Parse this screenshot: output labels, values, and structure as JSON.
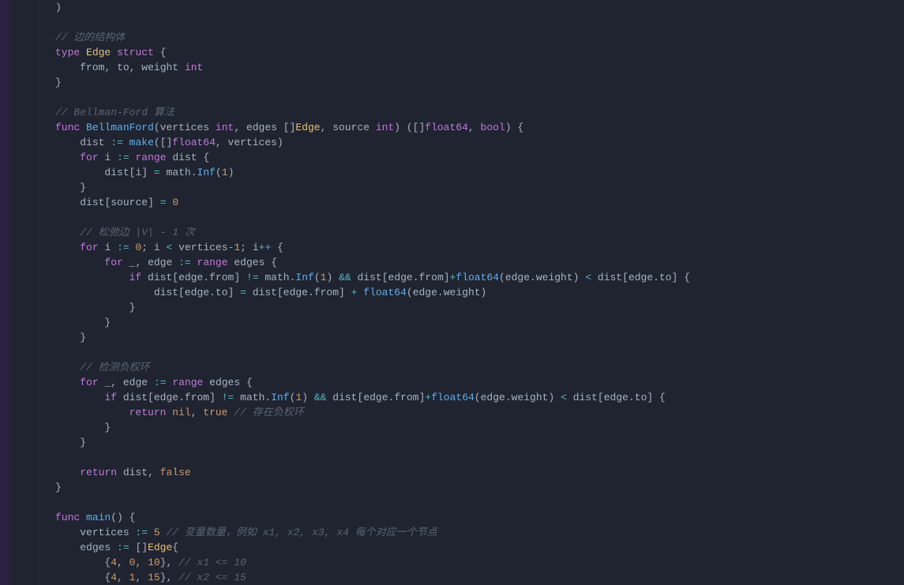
{
  "code": {
    "lines": [
      [
        [
          "punc",
          ")"
        ]
      ],
      [],
      [
        [
          "comment",
          "// 边的结构体"
        ]
      ],
      [
        [
          "keyword",
          "type"
        ],
        [
          "sp",
          " "
        ],
        [
          "struct",
          "Edge"
        ],
        [
          "sp",
          " "
        ],
        [
          "keyword",
          "struct"
        ],
        [
          "sp",
          " "
        ],
        [
          "punc",
          "{"
        ]
      ],
      [
        [
          "indent",
          "    "
        ],
        [
          "ident",
          "from"
        ],
        [
          "punc",
          ","
        ],
        [
          "sp",
          " "
        ],
        [
          "ident",
          "to"
        ],
        [
          "punc",
          ","
        ],
        [
          "sp",
          " "
        ],
        [
          "ident",
          "weight"
        ],
        [
          "sp",
          " "
        ],
        [
          "type",
          "int"
        ]
      ],
      [
        [
          "punc",
          "}"
        ]
      ],
      [],
      [
        [
          "comment",
          "// Bellman-Ford 算法"
        ]
      ],
      [
        [
          "keyword",
          "func"
        ],
        [
          "sp",
          " "
        ],
        [
          "func",
          "BellmanFord"
        ],
        [
          "punc",
          "("
        ],
        [
          "ident",
          "vertices"
        ],
        [
          "sp",
          " "
        ],
        [
          "type",
          "int"
        ],
        [
          "punc",
          ","
        ],
        [
          "sp",
          " "
        ],
        [
          "ident",
          "edges"
        ],
        [
          "sp",
          " "
        ],
        [
          "punc",
          "[]"
        ],
        [
          "struct",
          "Edge"
        ],
        [
          "punc",
          ","
        ],
        [
          "sp",
          " "
        ],
        [
          "ident",
          "source"
        ],
        [
          "sp",
          " "
        ],
        [
          "type",
          "int"
        ],
        [
          "punc",
          ")"
        ],
        [
          "sp",
          " "
        ],
        [
          "punc",
          "([]"
        ],
        [
          "type",
          "float64"
        ],
        [
          "punc",
          ","
        ],
        [
          "sp",
          " "
        ],
        [
          "type",
          "bool"
        ],
        [
          "punc",
          ")"
        ],
        [
          "sp",
          " "
        ],
        [
          "punc",
          "{"
        ]
      ],
      [
        [
          "indent",
          "    "
        ],
        [
          "ident",
          "dist"
        ],
        [
          "sp",
          " "
        ],
        [
          "op",
          ":="
        ],
        [
          "sp",
          " "
        ],
        [
          "func",
          "make"
        ],
        [
          "punc",
          "([]"
        ],
        [
          "type",
          "float64"
        ],
        [
          "punc",
          ","
        ],
        [
          "sp",
          " "
        ],
        [
          "ident",
          "vertices"
        ],
        [
          "punc",
          ")"
        ]
      ],
      [
        [
          "indent",
          "    "
        ],
        [
          "keyword",
          "for"
        ],
        [
          "sp",
          " "
        ],
        [
          "ident",
          "i"
        ],
        [
          "sp",
          " "
        ],
        [
          "op",
          ":="
        ],
        [
          "sp",
          " "
        ],
        [
          "keyword",
          "range"
        ],
        [
          "sp",
          " "
        ],
        [
          "ident",
          "dist"
        ],
        [
          "sp",
          " "
        ],
        [
          "punc",
          "{"
        ]
      ],
      [
        [
          "indent",
          "        "
        ],
        [
          "ident",
          "dist"
        ],
        [
          "punc",
          "["
        ],
        [
          "ident",
          "i"
        ],
        [
          "punc",
          "]"
        ],
        [
          "sp",
          " "
        ],
        [
          "op",
          "="
        ],
        [
          "sp",
          " "
        ],
        [
          "ident",
          "math"
        ],
        [
          "punc",
          "."
        ],
        [
          "func",
          "Inf"
        ],
        [
          "punc",
          "("
        ],
        [
          "num",
          "1"
        ],
        [
          "punc",
          ")"
        ]
      ],
      [
        [
          "indent",
          "    "
        ],
        [
          "punc",
          "}"
        ]
      ],
      [
        [
          "indent",
          "    "
        ],
        [
          "ident",
          "dist"
        ],
        [
          "punc",
          "["
        ],
        [
          "ident",
          "source"
        ],
        [
          "punc",
          "]"
        ],
        [
          "sp",
          " "
        ],
        [
          "op",
          "="
        ],
        [
          "sp",
          " "
        ],
        [
          "num",
          "0"
        ]
      ],
      [],
      [
        [
          "indent",
          "    "
        ],
        [
          "comment",
          "// 松弛边 |V| - 1 次"
        ]
      ],
      [
        [
          "indent",
          "    "
        ],
        [
          "keyword",
          "for"
        ],
        [
          "sp",
          " "
        ],
        [
          "ident",
          "i"
        ],
        [
          "sp",
          " "
        ],
        [
          "op",
          ":="
        ],
        [
          "sp",
          " "
        ],
        [
          "num",
          "0"
        ],
        [
          "punc",
          ";"
        ],
        [
          "sp",
          " "
        ],
        [
          "ident",
          "i"
        ],
        [
          "sp",
          " "
        ],
        [
          "op",
          "<"
        ],
        [
          "sp",
          " "
        ],
        [
          "ident",
          "vertices"
        ],
        [
          "op",
          "-"
        ],
        [
          "num",
          "1"
        ],
        [
          "punc",
          ";"
        ],
        [
          "sp",
          " "
        ],
        [
          "ident",
          "i"
        ],
        [
          "op",
          "++"
        ],
        [
          "sp",
          " "
        ],
        [
          "punc",
          "{"
        ]
      ],
      [
        [
          "indent",
          "        "
        ],
        [
          "keyword",
          "for"
        ],
        [
          "sp",
          " "
        ],
        [
          "ident",
          "_"
        ],
        [
          "punc",
          ","
        ],
        [
          "sp",
          " "
        ],
        [
          "ident",
          "edge"
        ],
        [
          "sp",
          " "
        ],
        [
          "op",
          ":="
        ],
        [
          "sp",
          " "
        ],
        [
          "keyword",
          "range"
        ],
        [
          "sp",
          " "
        ],
        [
          "ident",
          "edges"
        ],
        [
          "sp",
          " "
        ],
        [
          "punc",
          "{"
        ]
      ],
      [
        [
          "indent",
          "            "
        ],
        [
          "keyword",
          "if"
        ],
        [
          "sp",
          " "
        ],
        [
          "ident",
          "dist"
        ],
        [
          "punc",
          "["
        ],
        [
          "ident",
          "edge"
        ],
        [
          "punc",
          "."
        ],
        [
          "ident",
          "from"
        ],
        [
          "punc",
          "]"
        ],
        [
          "sp",
          " "
        ],
        [
          "op",
          "!="
        ],
        [
          "sp",
          " "
        ],
        [
          "ident",
          "math"
        ],
        [
          "punc",
          "."
        ],
        [
          "func",
          "Inf"
        ],
        [
          "punc",
          "("
        ],
        [
          "num",
          "1"
        ],
        [
          "punc",
          ")"
        ],
        [
          "sp",
          " "
        ],
        [
          "op",
          "&&"
        ],
        [
          "sp",
          " "
        ],
        [
          "ident",
          "dist"
        ],
        [
          "punc",
          "["
        ],
        [
          "ident",
          "edge"
        ],
        [
          "punc",
          "."
        ],
        [
          "ident",
          "from"
        ],
        [
          "punc",
          "]"
        ],
        [
          "op",
          "+"
        ],
        [
          "func",
          "float64"
        ],
        [
          "punc",
          "("
        ],
        [
          "ident",
          "edge"
        ],
        [
          "punc",
          "."
        ],
        [
          "ident",
          "weight"
        ],
        [
          "punc",
          ")"
        ],
        [
          "sp",
          " "
        ],
        [
          "op",
          "<"
        ],
        [
          "sp",
          " "
        ],
        [
          "ident",
          "dist"
        ],
        [
          "punc",
          "["
        ],
        [
          "ident",
          "edge"
        ],
        [
          "punc",
          "."
        ],
        [
          "ident",
          "to"
        ],
        [
          "punc",
          "]"
        ],
        [
          "sp",
          " "
        ],
        [
          "punc",
          "{"
        ]
      ],
      [
        [
          "indent",
          "                "
        ],
        [
          "ident",
          "dist"
        ],
        [
          "punc",
          "["
        ],
        [
          "ident",
          "edge"
        ],
        [
          "punc",
          "."
        ],
        [
          "ident",
          "to"
        ],
        [
          "punc",
          "]"
        ],
        [
          "sp",
          " "
        ],
        [
          "op",
          "="
        ],
        [
          "sp",
          " "
        ],
        [
          "ident",
          "dist"
        ],
        [
          "punc",
          "["
        ],
        [
          "ident",
          "edge"
        ],
        [
          "punc",
          "."
        ],
        [
          "ident",
          "from"
        ],
        [
          "punc",
          "]"
        ],
        [
          "sp",
          " "
        ],
        [
          "op",
          "+"
        ],
        [
          "sp",
          " "
        ],
        [
          "func",
          "float64"
        ],
        [
          "punc",
          "("
        ],
        [
          "ident",
          "edge"
        ],
        [
          "punc",
          "."
        ],
        [
          "ident",
          "weight"
        ],
        [
          "punc",
          ")"
        ]
      ],
      [
        [
          "indent",
          "            "
        ],
        [
          "punc",
          "}"
        ]
      ],
      [
        [
          "indent",
          "        "
        ],
        [
          "punc",
          "}"
        ]
      ],
      [
        [
          "indent",
          "    "
        ],
        [
          "punc",
          "}"
        ]
      ],
      [],
      [
        [
          "indent",
          "    "
        ],
        [
          "comment",
          "// 检测负权环"
        ]
      ],
      [
        [
          "indent",
          "    "
        ],
        [
          "keyword",
          "for"
        ],
        [
          "sp",
          " "
        ],
        [
          "ident",
          "_"
        ],
        [
          "punc",
          ","
        ],
        [
          "sp",
          " "
        ],
        [
          "ident",
          "edge"
        ],
        [
          "sp",
          " "
        ],
        [
          "op",
          ":="
        ],
        [
          "sp",
          " "
        ],
        [
          "keyword",
          "range"
        ],
        [
          "sp",
          " "
        ],
        [
          "ident",
          "edges"
        ],
        [
          "sp",
          " "
        ],
        [
          "punc",
          "{"
        ]
      ],
      [
        [
          "indent",
          "        "
        ],
        [
          "keyword",
          "if"
        ],
        [
          "sp",
          " "
        ],
        [
          "ident",
          "dist"
        ],
        [
          "punc",
          "["
        ],
        [
          "ident",
          "edge"
        ],
        [
          "punc",
          "."
        ],
        [
          "ident",
          "from"
        ],
        [
          "punc",
          "]"
        ],
        [
          "sp",
          " "
        ],
        [
          "op",
          "!="
        ],
        [
          "sp",
          " "
        ],
        [
          "ident",
          "math"
        ],
        [
          "punc",
          "."
        ],
        [
          "func",
          "Inf"
        ],
        [
          "punc",
          "("
        ],
        [
          "num",
          "1"
        ],
        [
          "punc",
          ")"
        ],
        [
          "sp",
          " "
        ],
        [
          "op",
          "&&"
        ],
        [
          "sp",
          " "
        ],
        [
          "ident",
          "dist"
        ],
        [
          "punc",
          "["
        ],
        [
          "ident",
          "edge"
        ],
        [
          "punc",
          "."
        ],
        [
          "ident",
          "from"
        ],
        [
          "punc",
          "]"
        ],
        [
          "op",
          "+"
        ],
        [
          "func",
          "float64"
        ],
        [
          "punc",
          "("
        ],
        [
          "ident",
          "edge"
        ],
        [
          "punc",
          "."
        ],
        [
          "ident",
          "weight"
        ],
        [
          "punc",
          ")"
        ],
        [
          "sp",
          " "
        ],
        [
          "op",
          "<"
        ],
        [
          "sp",
          " "
        ],
        [
          "ident",
          "dist"
        ],
        [
          "punc",
          "["
        ],
        [
          "ident",
          "edge"
        ],
        [
          "punc",
          "."
        ],
        [
          "ident",
          "to"
        ],
        [
          "punc",
          "]"
        ],
        [
          "sp",
          " "
        ],
        [
          "punc",
          "{"
        ]
      ],
      [
        [
          "indent",
          "            "
        ],
        [
          "keyword",
          "return"
        ],
        [
          "sp",
          " "
        ],
        [
          "bool",
          "nil"
        ],
        [
          "punc",
          ","
        ],
        [
          "sp",
          " "
        ],
        [
          "bool",
          "true"
        ],
        [
          "sp",
          " "
        ],
        [
          "comment",
          "// 存在负权环"
        ]
      ],
      [
        [
          "indent",
          "        "
        ],
        [
          "punc",
          "}"
        ]
      ],
      [
        [
          "indent",
          "    "
        ],
        [
          "punc",
          "}"
        ]
      ],
      [],
      [
        [
          "indent",
          "    "
        ],
        [
          "keyword",
          "return"
        ],
        [
          "sp",
          " "
        ],
        [
          "ident",
          "dist"
        ],
        [
          "punc",
          ","
        ],
        [
          "sp",
          " "
        ],
        [
          "bool",
          "false"
        ]
      ],
      [
        [
          "punc",
          "}"
        ]
      ],
      [],
      [
        [
          "keyword",
          "func"
        ],
        [
          "sp",
          " "
        ],
        [
          "func",
          "main"
        ],
        [
          "punc",
          "()"
        ],
        [
          "sp",
          " "
        ],
        [
          "punc",
          "{"
        ]
      ],
      [
        [
          "indent",
          "    "
        ],
        [
          "ident",
          "vertices"
        ],
        [
          "sp",
          " "
        ],
        [
          "op",
          ":="
        ],
        [
          "sp",
          " "
        ],
        [
          "num",
          "5"
        ],
        [
          "sp",
          " "
        ],
        [
          "comment",
          "// 变量数量，例如 x1, x2, x3, x4 每个对应一个节点"
        ]
      ],
      [
        [
          "indent",
          "    "
        ],
        [
          "ident",
          "edges"
        ],
        [
          "sp",
          " "
        ],
        [
          "op",
          ":="
        ],
        [
          "sp",
          " "
        ],
        [
          "punc",
          "[]"
        ],
        [
          "struct",
          "Edge"
        ],
        [
          "punc",
          "{"
        ]
      ],
      [
        [
          "indent",
          "        "
        ],
        [
          "punc",
          "{"
        ],
        [
          "num",
          "4"
        ],
        [
          "punc",
          ","
        ],
        [
          "sp",
          " "
        ],
        [
          "num",
          "0"
        ],
        [
          "punc",
          ","
        ],
        [
          "sp",
          " "
        ],
        [
          "num",
          "10"
        ],
        [
          "punc",
          "},"
        ],
        [
          "sp",
          " "
        ],
        [
          "comment",
          "// x1 <= 10"
        ]
      ],
      [
        [
          "indent",
          "        "
        ],
        [
          "punc",
          "{"
        ],
        [
          "num",
          "4"
        ],
        [
          "punc",
          ","
        ],
        [
          "sp",
          " "
        ],
        [
          "num",
          "1"
        ],
        [
          "punc",
          ","
        ],
        [
          "sp",
          " "
        ],
        [
          "num",
          "15"
        ],
        [
          "punc",
          "},"
        ],
        [
          "sp",
          " "
        ],
        [
          "comment",
          "// x2 <= 15"
        ]
      ]
    ]
  }
}
